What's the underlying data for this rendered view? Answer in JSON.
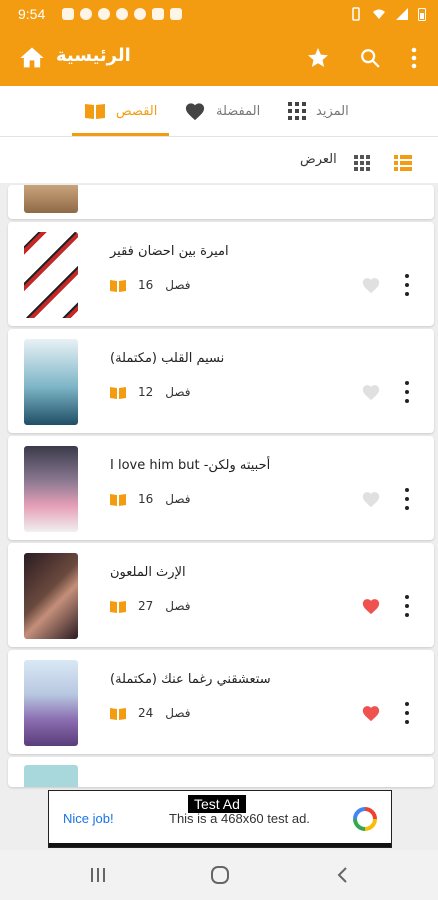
{
  "status_bar": {
    "time": "9:54"
  },
  "app_bar": {
    "title": "الرئيسية"
  },
  "tabs": [
    {
      "label": "المزيد",
      "icon": "grid-icon"
    },
    {
      "label": "المفضلة",
      "icon": "heart-icon"
    },
    {
      "label": "القصص",
      "icon": "book-icon",
      "active": true
    }
  ],
  "view_row": {
    "label": "العرض"
  },
  "stories": [
    {
      "title": "اميرة بين احضان فقير",
      "chapters": "16",
      "chapter_label": "فصل",
      "favorite": false
    },
    {
      "title": "نسيم القلب (مكتملة)",
      "chapters": "12",
      "chapter_label": "فصل",
      "favorite": false
    },
    {
      "title": "I love him but -أحبيته ولكن",
      "chapters": "16",
      "chapter_label": "فصل",
      "favorite": false
    },
    {
      "title": "الإرث الملعون",
      "chapters": "27",
      "chapter_label": "فصل",
      "favorite": true
    },
    {
      "title": "ستعشقني رغما عنك (مكتملة)",
      "chapters": "24",
      "chapter_label": "فصل",
      "favorite": true
    }
  ],
  "ad": {
    "tag": "Test Ad",
    "nice": "Nice job!",
    "text": "This is a 468x60 test ad."
  },
  "colors": {
    "primary": "#f39c12",
    "heart_active": "#ef5350",
    "heart_inactive": "#e0e0e0"
  }
}
